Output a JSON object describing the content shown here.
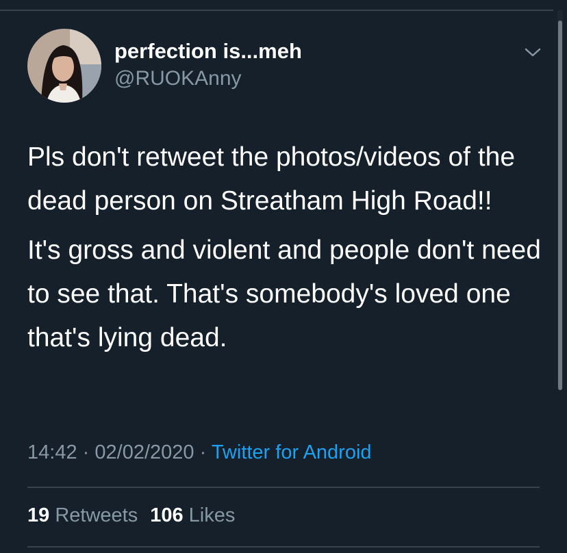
{
  "tweet": {
    "author": {
      "display_name": "perfection is...meh",
      "handle": "@RUOKAnny"
    },
    "paragraphs": [
      "Pls don't retweet the photos/videos of the dead person on Streatham High Road!!",
      "It's gross and violent and people don't need to see that. That's somebody's loved one that's lying dead."
    ],
    "time": "14:42",
    "date": "02/02/2020",
    "separator": "·",
    "source": "Twitter for Android",
    "retweets_count": "19",
    "retweets_label": "Retweets",
    "likes_count": "106",
    "likes_label": "Likes"
  },
  "icons": {
    "menu": "chevron-down-icon"
  },
  "colors": {
    "background": "#15202b",
    "text": "#ffffff",
    "secondary_text": "#8899a6",
    "link": "#1da1f2",
    "divider": "#38444d"
  }
}
